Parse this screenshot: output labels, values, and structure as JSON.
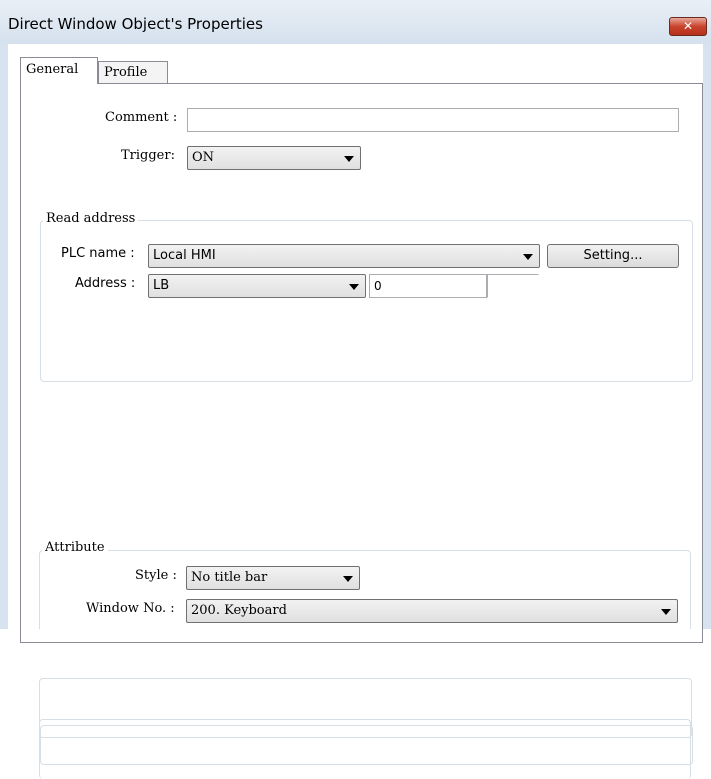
{
  "window": {
    "title": "Direct Window Object's Properties",
    "close_glyph": "✕"
  },
  "tabs": [
    {
      "label": "General",
      "selected": true
    },
    {
      "label": "Profile",
      "selected": false
    }
  ],
  "general": {
    "comment_label": "Comment :",
    "comment_value": "",
    "trigger_label": "Trigger:",
    "trigger_value": "ON"
  },
  "read_address": {
    "group_title": "Read address",
    "plc_name_label": "PLC name :",
    "plc_name_value": "Local HMI",
    "setting_button": "Setting...",
    "address_label": "Address :",
    "address_device": "LB",
    "address_value": "0",
    "address_extra": ""
  },
  "attribute": {
    "group_title": "Attribute",
    "style_label": "Style :",
    "style_value": "No title bar",
    "window_no_label": "Window No. :",
    "window_no_value": "200. Keyboard"
  },
  "icons": {
    "close": "close-icon",
    "dropdown": "chevron-down-icon"
  },
  "colors": {
    "titlebar": "#dde7f1",
    "close_button": "#c9432c"
  }
}
